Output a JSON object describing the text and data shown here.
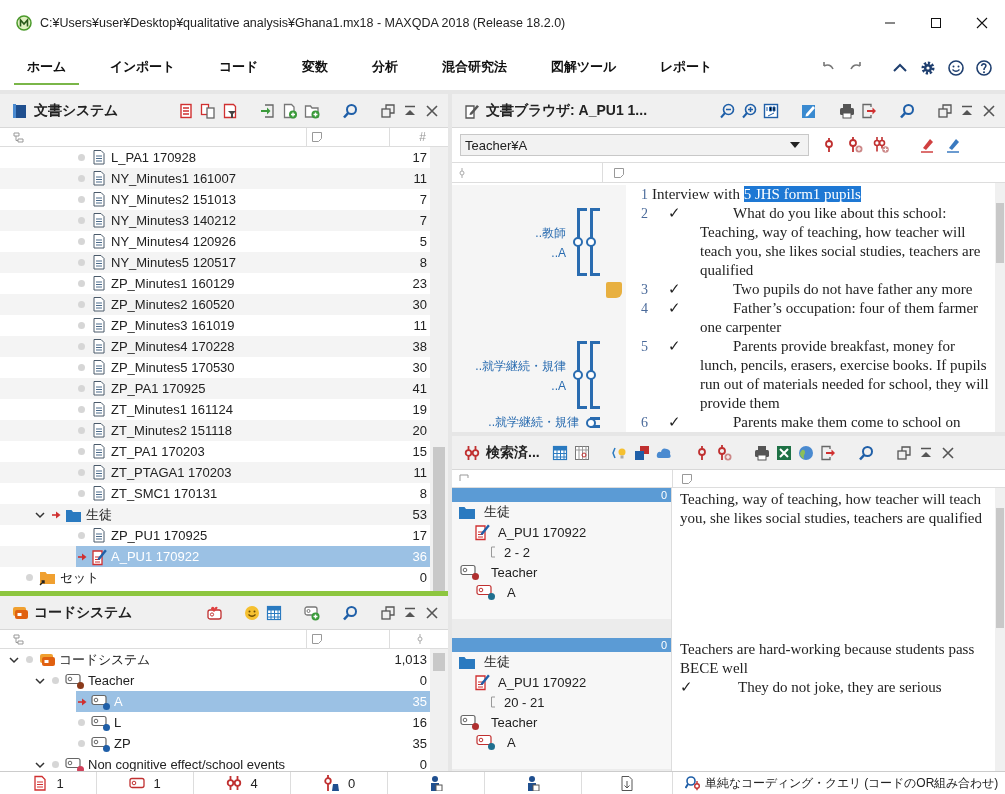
{
  "window": {
    "title": "C:¥Users¥user¥Desktop¥qualitative analysis¥Ghana1.mx18 - MAXQDA 2018 (Release 18.2.0)"
  },
  "ribbon": {
    "tabs": [
      {
        "label": "ホーム",
        "selected": true
      },
      {
        "label": "インポート",
        "selected": false
      },
      {
        "label": "コード",
        "selected": false
      },
      {
        "label": "変数",
        "selected": false
      },
      {
        "label": "分析",
        "selected": false
      },
      {
        "label": "混合研究法",
        "selected": false
      },
      {
        "label": "図解ツール",
        "selected": false
      },
      {
        "label": "レポート",
        "selected": false
      }
    ]
  },
  "document_system": {
    "title": "文書システム",
    "count_header": "#",
    "tree": [
      {
        "children": [
          {
            "children": [
              {
                "label": "L_PA1 170928",
                "kind": "document",
                "count": "17",
                "activated": false,
                "selected": false
              },
              {
                "label": "NY_Minutes1 161007",
                "kind": "document",
                "count": "11",
                "activated": false,
                "selected": false
              },
              {
                "label": "NY_Minutes2 151013",
                "kind": "document",
                "count": "7",
                "activated": false,
                "selected": false
              },
              {
                "label": "NY_Minutes3 140212",
                "kind": "document",
                "count": "7",
                "activated": false,
                "selected": false
              },
              {
                "label": "NY_Minutes4 120926",
                "kind": "document",
                "count": "5",
                "activated": false,
                "selected": false
              },
              {
                "label": "NY_Minutes5 120517",
                "kind": "document",
                "count": "8",
                "activated": false,
                "selected": false
              },
              {
                "label": "ZP_Minutes1 160129",
                "kind": "document",
                "count": "23",
                "activated": false,
                "selected": false
              },
              {
                "label": "ZP_Minutes2 160520",
                "kind": "document",
                "count": "30",
                "activated": false,
                "selected": false
              },
              {
                "label": "ZP_Minutes3 161019",
                "kind": "document",
                "count": "11",
                "activated": false,
                "selected": false
              },
              {
                "label": "ZP_Minutes4 170228",
                "kind": "document",
                "count": "38",
                "activated": false,
                "selected": false
              },
              {
                "label": "ZP_Minutes5 170530",
                "kind": "document",
                "count": "30",
                "activated": false,
                "selected": false
              },
              {
                "label": "ZP_PA1 170925",
                "kind": "document",
                "count": "41",
                "activated": false,
                "selected": false
              },
              {
                "label": "ZT_Minutes1 161124",
                "kind": "document",
                "count": "19",
                "activated": false,
                "selected": false
              },
              {
                "label": "ZT_Minutes2 151118",
                "kind": "document",
                "count": "20",
                "activated": false,
                "selected": false
              },
              {
                "label": "ZT_PA1 170203",
                "kind": "document",
                "count": "15",
                "activated": false,
                "selected": false
              },
              {
                "label": "ZT_PTAGA1 170203",
                "kind": "document",
                "count": "11",
                "activated": false,
                "selected": false
              },
              {
                "label": "ZT_SMC1 170131",
                "kind": "document",
                "count": "8",
                "activated": false,
                "selected": false
              }
            ]
          },
          {
            "label": "生徒",
            "kind": "folder",
            "count": "53",
            "expanded": true,
            "activated": true,
            "selected": false,
            "children": [
              {
                "label": "ZP_PU1 170925",
                "kind": "document",
                "count": "17",
                "activated": false,
                "selected": false
              },
              {
                "label": "A_PU1 170922",
                "kind": "edited-document",
                "count": "36",
                "activated": true,
                "selected": true
              }
            ]
          }
        ]
      },
      {
        "label": "セット",
        "kind": "set",
        "count": "0",
        "activated": false,
        "selected": false
      }
    ]
  },
  "code_system": {
    "title": "コードシステム",
    "tree": [
      {
        "label": "コードシステム",
        "kind": "root",
        "count": "1,013",
        "expanded": true,
        "activated": false,
        "selected": false,
        "children": [
          {
            "label": "Teacher",
            "kind": "code",
            "color": "#8b3a1a",
            "count": "0",
            "expanded": true,
            "activated": false,
            "selected": false,
            "children": [
              {
                "label": "A",
                "kind": "code",
                "color": "#1f5fa8",
                "count": "35",
                "activated": true,
                "selected": true
              },
              {
                "label": "L",
                "kind": "code",
                "color": "#1f5fa8",
                "count": "16",
                "activated": false,
                "selected": false
              },
              {
                "label": "ZP",
                "kind": "code",
                "color": "#1f5fa8",
                "count": "35",
                "activated": false,
                "selected": false
              }
            ]
          },
          {
            "label": "Non cognitive effect/school events",
            "kind": "code",
            "color": "#d0405a",
            "count": "0",
            "expanded": true,
            "activated": false,
            "selected": false
          }
        ]
      }
    ]
  },
  "document_browser": {
    "title": "文書ブラウザ: A_PU1 1...",
    "code_filter": "Teacher¥A",
    "paragraphs": [
      {
        "number": "1",
        "memo": false,
        "text": "Interview with ",
        "selected_text": "5 JHS form1 pupils"
      },
      {
        "number": "2",
        "check": "✓",
        "memo": false,
        "text": "What do you like about this school: Teaching, way of teaching, how teacher will teach you, she likes social studies, teachers are qualified",
        "codes": [
          {
            "label": "..教師"
          },
          {
            "label": "..A"
          }
        ]
      },
      {
        "number": "3",
        "check": "✓",
        "memo": true,
        "text": "Two pupils do not have father any more"
      },
      {
        "number": "4",
        "check": "✓",
        "memo": false,
        "text": "Father’s occupation: four of them farmer one carpenter"
      },
      {
        "number": "5",
        "check": "✓",
        "memo": false,
        "text": "Parents provide breakfast, money for lunch, pencils, erasers, exercise books. If pupils run out of materials needed for school, they will provide them",
        "codes": [
          {
            "label": "..就学継続・規律"
          },
          {
            "label": "..A"
          }
        ]
      },
      {
        "number": "6",
        "check": "✓",
        "memo": false,
        "text": "Parents make them come to school on",
        "codes": [
          {
            "label": "..就学継続・規律"
          }
        ]
      }
    ]
  },
  "retrieved_segments": {
    "title": "検索済...",
    "segments": [
      {
        "weight": "0",
        "group": "生徒",
        "document": "A_PU1 170922",
        "range": "2 - 2",
        "parent_code": {
          "label": "Teacher",
          "color": "#b03030"
        },
        "code": {
          "label": "A",
          "color": "#1f6f8f"
        },
        "paragraphs": [
          {
            "text": "Teaching, way of teaching, how teacher will teach you, she likes social studies, teachers are qualified"
          }
        ]
      },
      {
        "weight": "0",
        "group": "生徒",
        "document": "A_PU1 170922",
        "range": "20 - 21",
        "parent_code": {
          "label": "Teacher",
          "color": "#b03030"
        },
        "code": {
          "label": "A",
          "color": "#1f6f8f"
        },
        "paragraphs": [
          {
            "text": "Teachers are hard-working because students pass BECE well"
          },
          {
            "text": "They do not joke, they are serious",
            "check": "✓"
          }
        ]
      }
    ]
  },
  "status_bar": {
    "counts": [
      {
        "kind": "documents",
        "value": "1"
      },
      {
        "kind": "codes",
        "value": "1"
      },
      {
        "kind": "codings",
        "value": "4"
      },
      {
        "kind": "weight",
        "value": "0"
      }
    ],
    "query": "単純なコーディング・クエリ (コードのOR組み合わせ)"
  }
}
